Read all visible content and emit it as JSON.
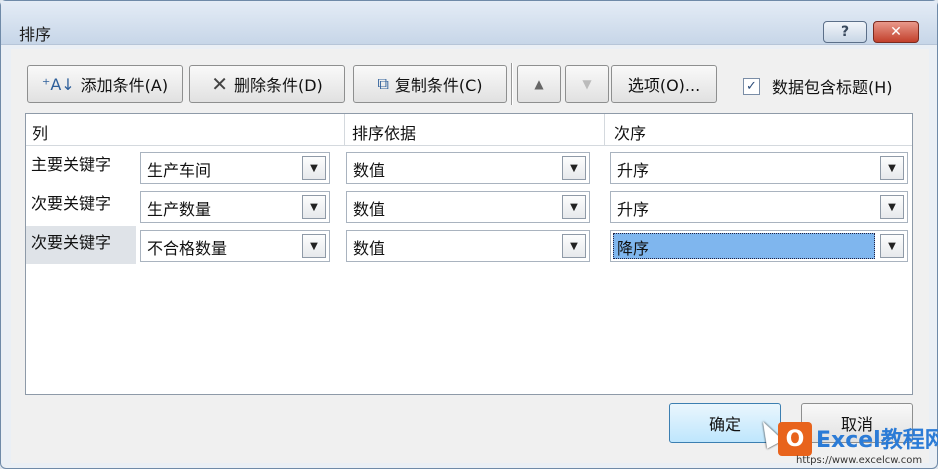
{
  "window": {
    "title": "排序",
    "help_label": "?",
    "close_label": "✕"
  },
  "toolbar": {
    "add_label": "添加条件(A)",
    "delete_label": "删除条件(D)",
    "copy_label": "复制条件(C)",
    "move_up_label": "▲",
    "move_down_label": "▼",
    "options_label": "选项(O)...",
    "header_checkbox": {
      "label": "数据包含标题(H)",
      "checked": true,
      "mark": "✓"
    }
  },
  "grid": {
    "columns": [
      "列",
      "排序依据",
      "次序"
    ],
    "rows": [
      {
        "label": "主要关键字",
        "column": "生产车间",
        "sort_on": "数值",
        "order": "升序",
        "selected": false
      },
      {
        "label": "次要关键字",
        "column": "生产数量",
        "sort_on": "数值",
        "order": "升序",
        "selected": false
      },
      {
        "label": "次要关键字",
        "column": "不合格数量",
        "sort_on": "数值",
        "order": "降序",
        "selected": true
      }
    ]
  },
  "footer": {
    "ok_label": "确定",
    "cancel_label": "取消"
  },
  "icons": {
    "add": "sort-add-icon",
    "delete": "delete-x-icon",
    "copy": "copy-icon",
    "dropdown": "chevron-down-icon"
  },
  "watermark": {
    "name": "Excel教程网",
    "url": "https://www.excelcw.com",
    "logo_letter": "O"
  },
  "colors": {
    "selection": "#7fb6ee",
    "close_button": "#c2402c",
    "watermark_orange": "#e8631c",
    "watermark_blue": "#2b7bd6"
  }
}
